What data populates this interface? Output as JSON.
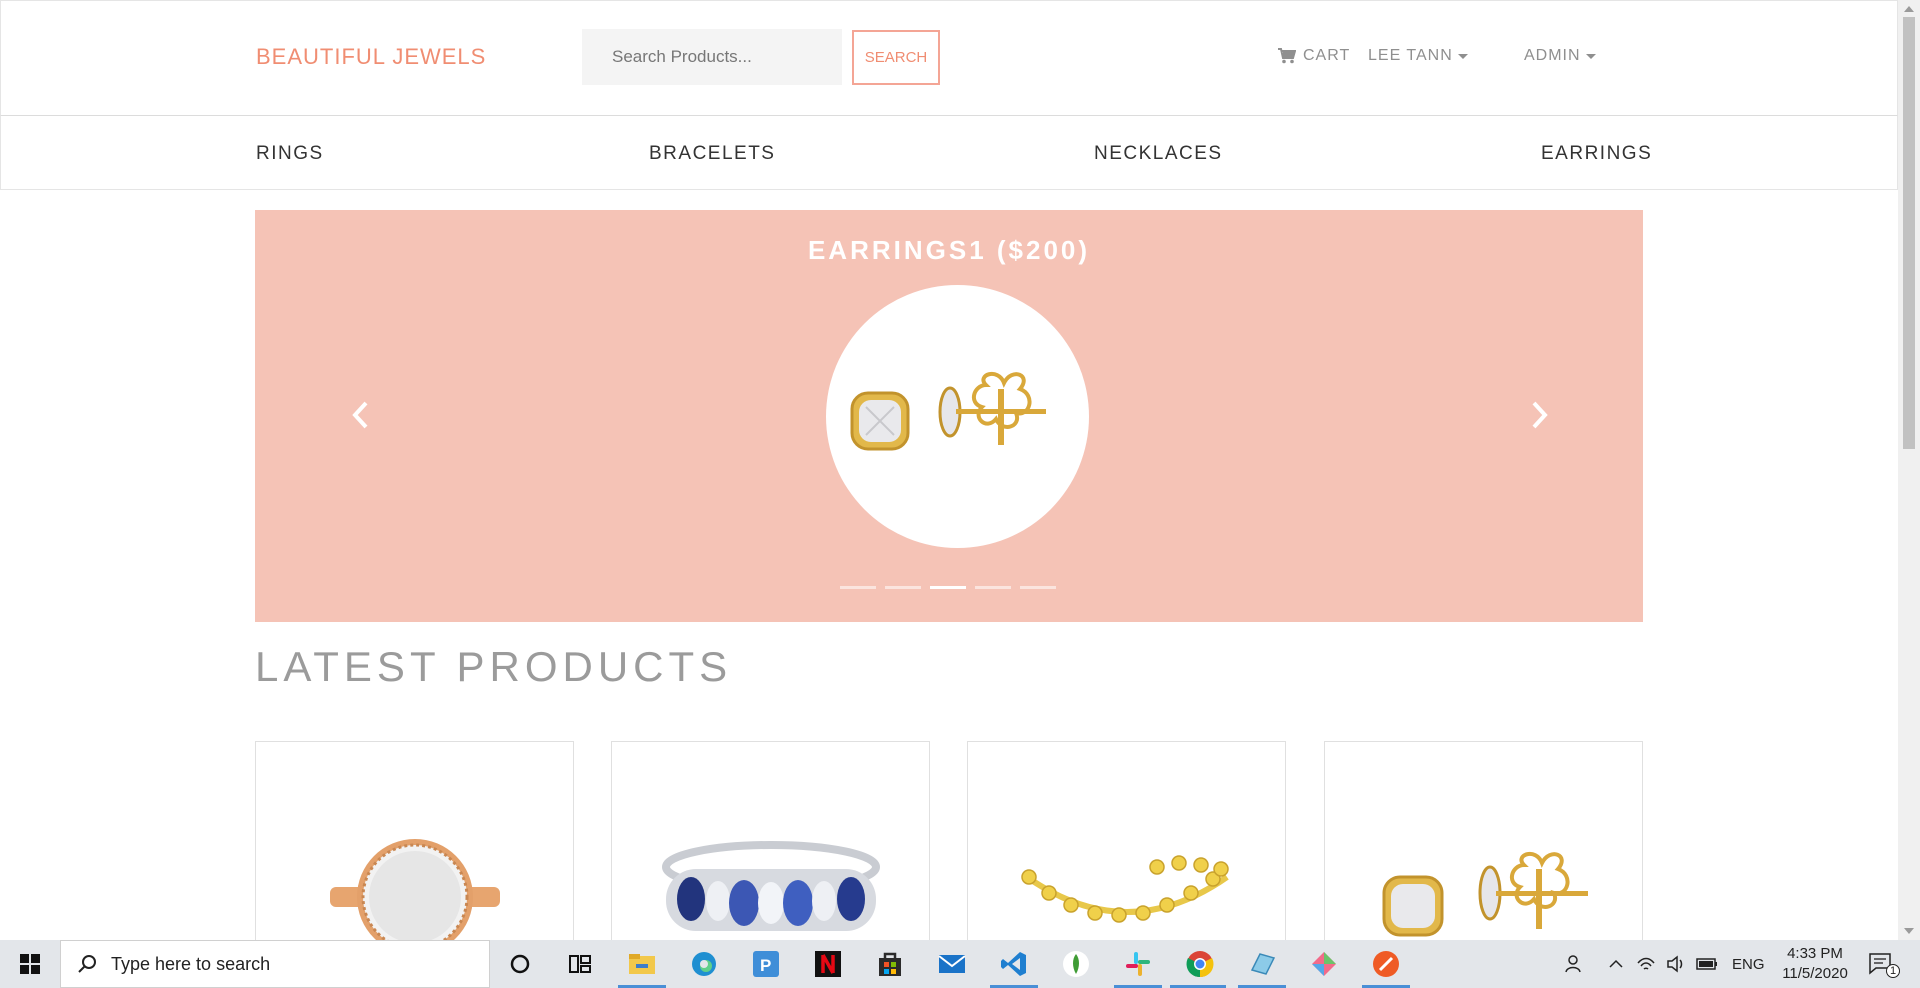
{
  "header": {
    "brand": "BEAUTIFUL JEWELS",
    "search_placeholder": "Search Products...",
    "search_button": "SEARCH",
    "cart_label": "CART",
    "user_label": "LEE TANN",
    "admin_label": "ADMIN"
  },
  "categories": [
    "RINGS",
    "BRACELETS",
    "NECKLACES",
    "EARRINGS"
  ],
  "carousel": {
    "title": "EARRINGS1 ($200)",
    "slide_count": 5,
    "active_index": 2
  },
  "latest": {
    "title": "LATEST PRODUCTS",
    "products": [
      {
        "image": "rose-gold-ring-icon"
      },
      {
        "image": "sapphire-band-ring-icon"
      },
      {
        "image": "gold-bracelet-icon"
      },
      {
        "image": "diamond-stud-earrings-icon"
      }
    ]
  },
  "colors": {
    "brand": "#f08d72",
    "carousel_bg": "#f5c3b6"
  },
  "taskbar": {
    "search_placeholder": "Type here to search",
    "language": "ENG",
    "time": "4:33 PM",
    "date": "11/5/2020",
    "notification_count": "1"
  }
}
